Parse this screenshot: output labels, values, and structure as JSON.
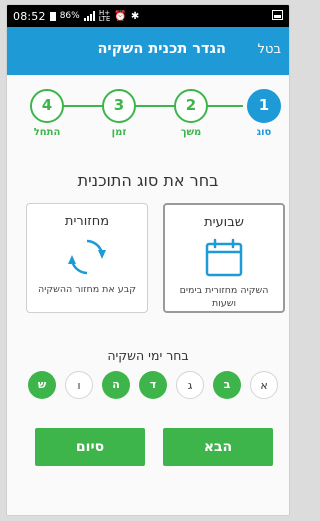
{
  "status_bar": {
    "time": "08:52",
    "battery": "86%",
    "network": "H+",
    "network_sub": "LTE"
  },
  "app_bar": {
    "title": "הגדר תכנית השקיה",
    "cancel_label": "בטל"
  },
  "steps": [
    {
      "number": "1",
      "label": "סוג",
      "state": "active"
    },
    {
      "number": "2",
      "label": "משך",
      "state": "pending"
    },
    {
      "number": "3",
      "label": "זמן",
      "state": "pending"
    },
    {
      "number": "4",
      "label": "התחל",
      "state": "pending"
    }
  ],
  "heading": "בחר את סוג התוכנית",
  "program_types": {
    "weekly": {
      "title": "שבועית",
      "description": "השקיה מחזורית בימים ושעות",
      "icon": "calendar-icon",
      "selected": true
    },
    "cyclic": {
      "title": "מחזורית",
      "description": "קבע את מחזור ההשקיה",
      "icon": "cycle-icon",
      "selected": false
    }
  },
  "days_title": "בחר ימי השקיה",
  "days": [
    {
      "label": "א",
      "selected": false
    },
    {
      "label": "ב",
      "selected": true
    },
    {
      "label": "ג",
      "selected": false
    },
    {
      "label": "ד",
      "selected": true
    },
    {
      "label": "ה",
      "selected": true
    },
    {
      "label": "ו",
      "selected": false
    },
    {
      "label": "ש",
      "selected": true
    }
  ],
  "buttons": {
    "next": "הבא",
    "finish": "סיום"
  },
  "colors": {
    "primary": "#1e9ad6",
    "green": "#3db54a"
  }
}
